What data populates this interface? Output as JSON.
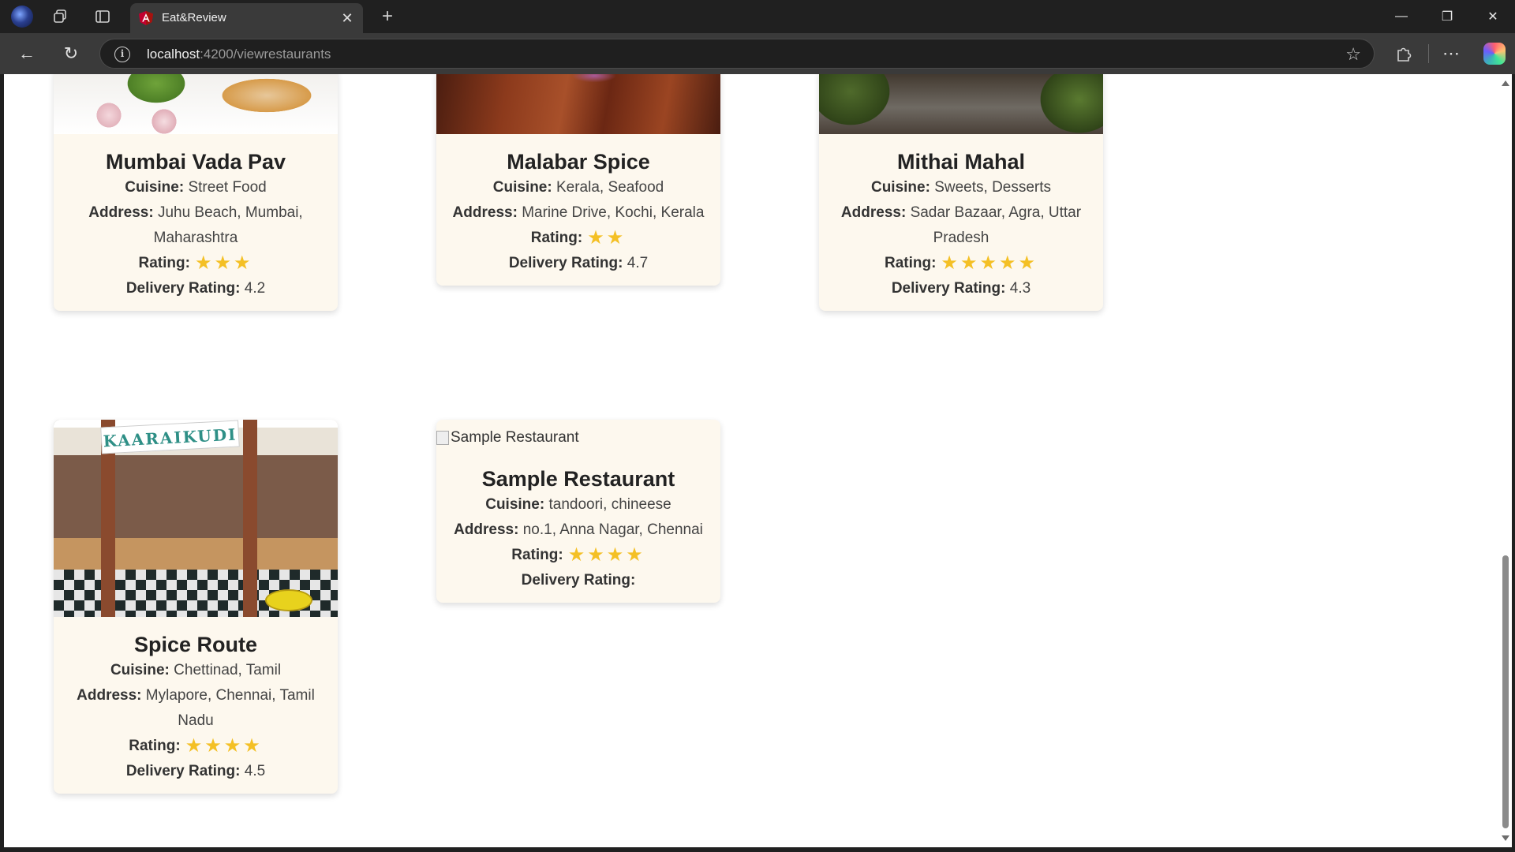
{
  "browser": {
    "tab_title": "Eat&Review",
    "url_host": "localhost",
    "url_path": ":4200/viewrestaurants"
  },
  "icons": {
    "profile": "profile-avatar-icon",
    "workspaces": "workspaces-icon",
    "tab_actions": "tab-actions-icon",
    "favicon": "angular-logo-icon",
    "close": "close-icon",
    "new_tab": "plus-icon",
    "back": "back-arrow-icon",
    "reload": "reload-icon",
    "site_info": "info-icon",
    "favorite": "star-outline-icon",
    "extensions": "puzzle-icon",
    "menu": "more-icon",
    "copilot": "copilot-icon",
    "rating_star": "star-filled-icon"
  },
  "labels": {
    "cuisine": "Cuisine:",
    "address": "Address:",
    "rating": "Rating:",
    "delivery": "Delivery Rating:"
  },
  "restaurants": [
    {
      "name": "Mumbai Vada Pav",
      "cuisine": "Street Food",
      "address": "Juhu Beach, Mumbai, Maharashtra",
      "rating_stars": 3,
      "delivery_rating": "4.2"
    },
    {
      "name": "Malabar Spice",
      "cuisine": "Kerala, Seafood",
      "address": "Marine Drive, Kochi, Kerala",
      "rating_stars": 2,
      "delivery_rating": "4.7"
    },
    {
      "name": "Mithai Mahal",
      "cuisine": "Sweets, Desserts",
      "address": "Sadar Bazaar, Agra, Uttar Pradesh",
      "rating_stars": 5,
      "delivery_rating": "4.3"
    },
    {
      "name": "Spice Route",
      "cuisine": "Chettinad, Tamil",
      "address": "Mylapore, Chennai, Tamil Nadu",
      "rating_stars": 4,
      "delivery_rating": "4.5",
      "photo_sign": "KAARAIKUDI"
    },
    {
      "name": "Sample Restaurant",
      "cuisine": "tandoori, chineese",
      "address": "no.1, Anna Nagar, Chennai",
      "rating_stars": 4,
      "delivery_rating": "",
      "image_alt": "Sample Restaurant"
    }
  ],
  "colors": {
    "card_bg": "#fdf8ee",
    "star": "#f4c025",
    "chrome_bg": "#202020"
  }
}
